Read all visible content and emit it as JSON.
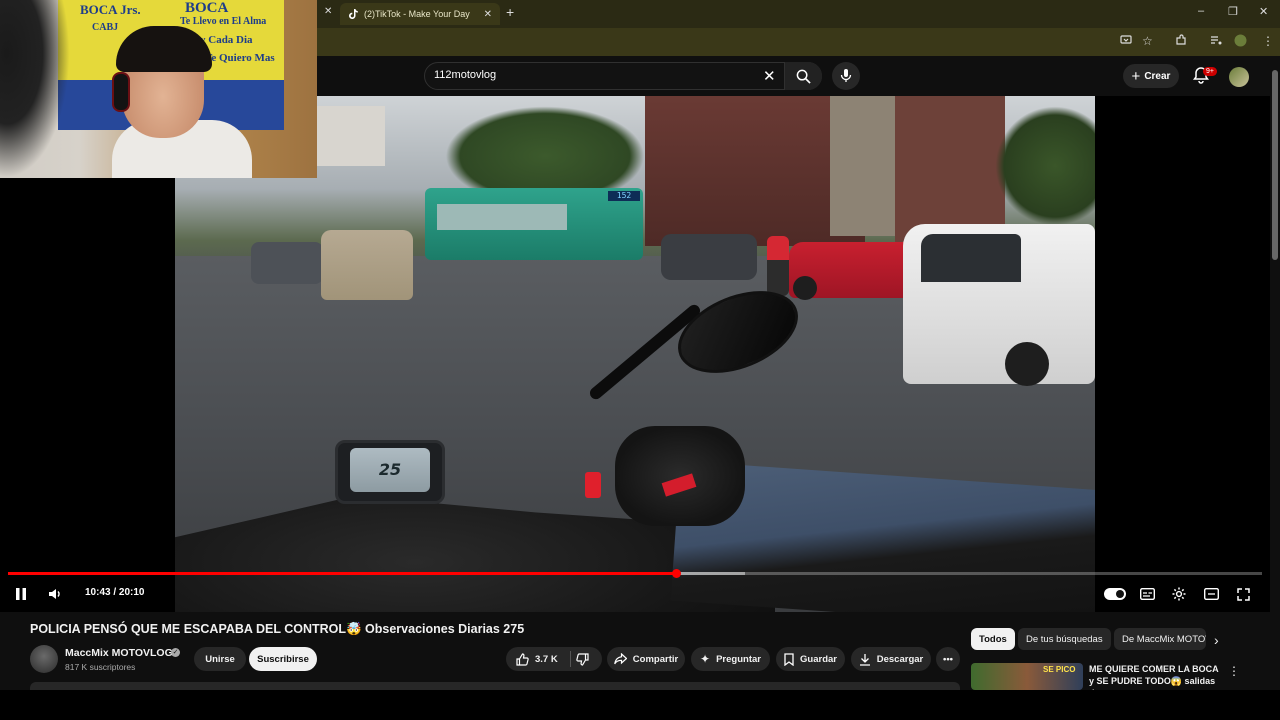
{
  "browser": {
    "tab_title": "(2)TikTok - Make Your Day",
    "tab_icon": "tiktok-icon",
    "new_tab_label": "+",
    "window_controls": [
      "–",
      "❐",
      "✕"
    ]
  },
  "youtube": {
    "search_value": "112motovlog",
    "create_label": "Crear",
    "notifications_badge": "9+"
  },
  "webcam_overlay": {
    "flag_line1": "BOCA Jrs.",
    "flag_line2": "BOCA",
    "flag_line3": "Te Llevo en El Alma",
    "flag_line4": "y Cada Dia",
    "flag_line5": "Te Quiero Mas",
    "crest": "CABJ"
  },
  "video_scene": {
    "dash_speed": "25",
    "bus_sign": "152"
  },
  "player": {
    "time_current": "10:43",
    "time_separator": " / ",
    "time_total": "20:10",
    "progress_fraction": 0.533,
    "buffered_fraction": 0.588,
    "accent_color": "#ff0000"
  },
  "video": {
    "title": "POLICIA PENSÓ QUE ME ESCAPABA DEL CONTROL🤯 Observaciones Diarias 275",
    "channel_name": "MaccMix MOTOVLOG",
    "subscribers": "817 K suscriptores",
    "join_label": "Unirse",
    "subscribe_label": "Suscribirse",
    "like_count": "3.7 K",
    "share_label": "Compartir",
    "ask_label": "Preguntar",
    "save_label": "Guardar",
    "download_label": "Descargar"
  },
  "filter_chips": [
    "Todos",
    "De tus búsquedas",
    "De MaccMix MOTOVLOG"
  ],
  "recommendation": {
    "title": "ME QUIERE COMER LA BOCA y SE PUDRE TODO😱 salidas de...",
    "thumb_text": "SE PICO"
  }
}
